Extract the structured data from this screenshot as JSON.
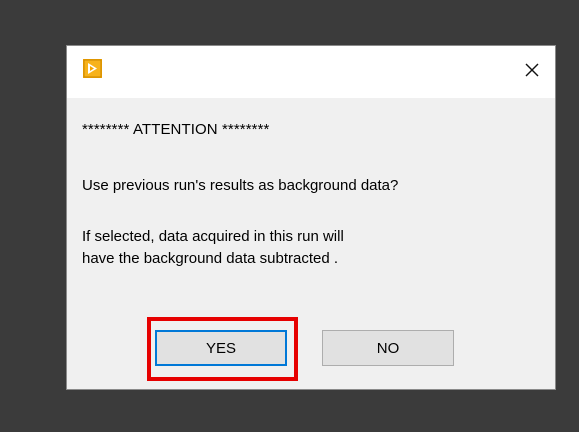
{
  "dialog": {
    "close_glyph": "✕",
    "icon": "labview-arrow-icon",
    "attention_line": "******** ATTENTION ********",
    "question": "Use previous run's results as background data?",
    "note_line1": "If selected, data acquired in this run will",
    "note_line2": "have the background data subtracted .",
    "yes_label": "YES",
    "no_label": "NO"
  },
  "colors": {
    "backdrop": "#3b3b3b",
    "dialog_bg": "#f0f0f0",
    "titlebar_bg": "#ffffff",
    "icon_bg": "#f5a400",
    "highlight": "#e60000",
    "focus_border": "#0078d7"
  }
}
